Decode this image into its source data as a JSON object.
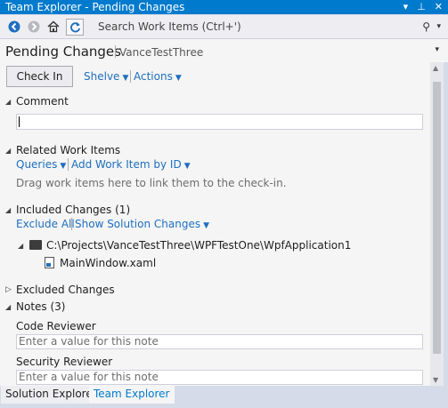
{
  "window": {
    "title": "Team Explorer - Pending Changes",
    "controls": {
      "dropdown": "▾",
      "pin": "⊥",
      "close": "✕"
    }
  },
  "navbar": {
    "back_icon": "back-arrow-icon",
    "forward_icon": "forward-arrow-icon",
    "home_icon": "home-icon",
    "refresh_icon": "refresh-icon",
    "search_placeholder": "Search Work Items (Ctrl+')",
    "search_glyph": "⚲",
    "search_caret": "▾"
  },
  "header": {
    "title": "Pending Changes",
    "subtitle": "VanceTestThree",
    "dropdown_glyph": "▾"
  },
  "toolbar": {
    "checkin_label": "Check In",
    "shelve_label": "Shelve",
    "actions_label": "Actions"
  },
  "comment": {
    "title": "Comment",
    "value": ""
  },
  "related_work_items": {
    "title": "Related Work Items",
    "queries_label": "Queries",
    "add_label": "Add Work Item by ID",
    "hint": "Drag work items here to link them to the check-in."
  },
  "included_changes": {
    "title": "Included Changes (1)",
    "exclude_all_label": "Exclude All",
    "show_solution_label": "Show Solution Changes",
    "folder_path": "C:\\Projects\\VanceTestThree\\WPFTestOne\\WpfApplication1",
    "file_name": "MainWindow.xaml"
  },
  "excluded_changes": {
    "title": "Excluded Changes"
  },
  "notes": {
    "title": "Notes (3)",
    "items": [
      {
        "label": "Code Reviewer",
        "placeholder": "Enter a value for this note"
      },
      {
        "label": "Security Reviewer",
        "placeholder": "Enter a value for this note"
      }
    ]
  },
  "bottom_tabs": {
    "solution_explorer": "Solution Explorer",
    "team_explorer": "Team Explorer"
  },
  "colors": {
    "titlebar": "#007acc",
    "link": "#1e6fbf",
    "panel_bg": "#f5f5f5"
  }
}
